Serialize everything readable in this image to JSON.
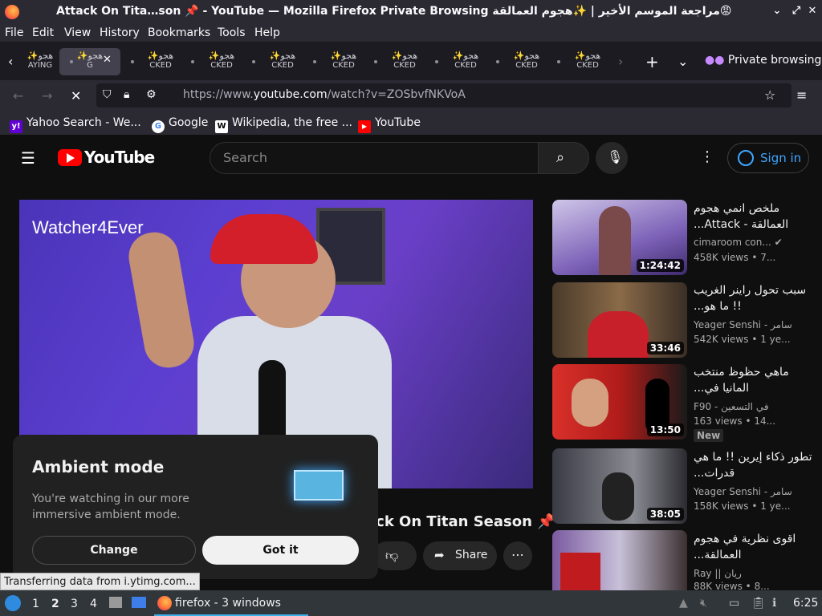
{
  "window": {
    "title": "Attack On Tita…son 📌 - YouTube — Mozilla Firefox Private Browsing مراجعة الموسم الأخير | ✨هجوم العمالقة😡"
  },
  "menu": [
    "File",
    "Edit",
    "View",
    "History",
    "Bookmarks",
    "Tools",
    "Help"
  ],
  "tabs": [
    {
      "label": "✨هجو",
      "sub": "AYING"
    },
    {
      "label": "✨هجو",
      "sub": "G"
    },
    {
      "label": "✨هجو",
      "sub": "CKED"
    },
    {
      "label": "✨هجو",
      "sub": "CKED"
    },
    {
      "label": "✨هجو",
      "sub": "CKED"
    },
    {
      "label": "✨هجو",
      "sub": "CKED"
    },
    {
      "label": "✨هجو",
      "sub": "CKED"
    },
    {
      "label": "✨هجو",
      "sub": "CKED"
    },
    {
      "label": "✨هجو",
      "sub": "CKED"
    },
    {
      "label": "✨هجو",
      "sub": "CKED"
    }
  ],
  "private_label": "Private browsing",
  "url": {
    "prefix": "https://www.",
    "host": "youtube.com",
    "path": "/watch?v=ZOSbvfNKVoA"
  },
  "bookmarks": [
    {
      "label": "Yahoo Search - We...",
      "icon": "y!"
    },
    {
      "label": "Google",
      "icon": "G"
    },
    {
      "label": "Wikipedia, the free ...",
      "icon": "W"
    },
    {
      "label": "YouTube",
      "icon": "▶"
    }
  ],
  "yt": {
    "logo": "YouTube",
    "search_placeholder": "Search",
    "signin": "Sign in"
  },
  "video": {
    "watermark": "Watcher4Ever",
    "title": "ack On Titan Season 📌",
    "share": "Share"
  },
  "sidebar": [
    {
      "title": "ملخص انمي هجوم العمالقة - Attack...",
      "channel": "cimaroom con...",
      "views": "458K views",
      "age": "• 7...",
      "duration": "1:24:42",
      "badge": ""
    },
    {
      "title": "سبب تحول راينر الغريب !! ما هو...",
      "channel": "Yeager Senshi - سامر",
      "views": "542K views",
      "age": "• 1 ye...",
      "duration": "33:46",
      "badge": ""
    },
    {
      "title": "ماهي حظوظ منتخب المانيا في...",
      "channel": "F90 - في التسعين",
      "views": "163 views",
      "age": "• 14...",
      "duration": "13:50",
      "badge": "New"
    },
    {
      "title": "تطور ذكاء إيرين !! ما هي قدرات...",
      "channel": "Yeager Senshi - سامر",
      "views": "158K views",
      "age": "• 1 ye...",
      "duration": "38:05",
      "badge": ""
    },
    {
      "title": "اقوى نظرية في هجوم العمالقة...",
      "channel": "Ray || ريان",
      "views": "88K views",
      "age": "• 8...",
      "duration": "",
      "badge": ""
    }
  ],
  "ambient": {
    "title": "Ambient mode",
    "text": "You're watching in our more immersive ambient mode.",
    "change": "Change",
    "got_it": "Got it"
  },
  "status": "Transferring data from i.ytimg.com...",
  "taskbar": {
    "workspaces": [
      "1",
      "2",
      "3",
      "4"
    ],
    "task": "firefox - 3 windows",
    "clock": "6:25"
  },
  "colors": {
    "yt_red": "#ff0000",
    "link_blue": "#3ea6ff"
  }
}
